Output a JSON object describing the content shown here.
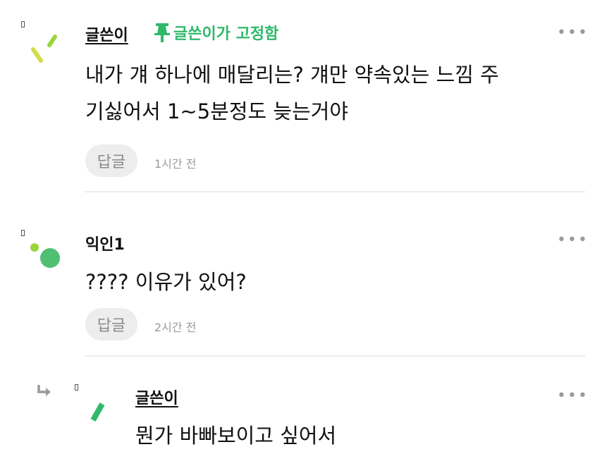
{
  "comments": [
    {
      "author": "글쓴이",
      "pin_label": "글쓴이가 고정함",
      "body_lines": [
        "내가 걔 하나에 매달리는? 걔만 약속있는 느낌 주",
        "기싫어서 1~5분정도 늦는거야"
      ],
      "reply_label": "답글",
      "time": "1시간 전",
      "more": "•••"
    },
    {
      "author": "익인1",
      "body_lines": [
        "???? 이유가 있어?"
      ],
      "reply_label": "답글",
      "time": "2시간 전",
      "more": "•••"
    },
    {
      "author": "글쓴이",
      "body_lines": [
        "뭔가 바빠보이고 싶어서"
      ],
      "more": "•••"
    }
  ],
  "colors": {
    "pin_green": "#2fb96b",
    "avatar_green": "#4fbf73",
    "avatar_yellow": "#d4dc4a",
    "avatar_lime": "#9ad53b"
  },
  "icons": [
    "pin-icon",
    "more-icon",
    "reply-arrow-icon"
  ]
}
